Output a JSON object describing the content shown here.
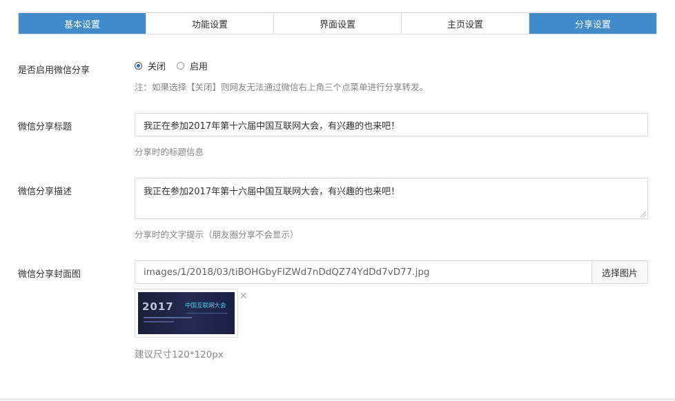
{
  "tabs": [
    {
      "label": "基本设置",
      "active": true
    },
    {
      "label": "功能设置",
      "active": false
    },
    {
      "label": "界面设置",
      "active": false
    },
    {
      "label": "主页设置",
      "active": false
    },
    {
      "label": "分享设置",
      "active": true
    }
  ],
  "share_enable": {
    "label": "是否启用微信分享",
    "options": [
      {
        "label": "关闭",
        "checked": true
      },
      {
        "label": "启用",
        "checked": false
      }
    ],
    "help": "注：如果选择【关闭】则网友无法通过微信右上角三个点菜单进行分享转发。"
  },
  "share_title": {
    "label": "微信分享标题",
    "value": "我正在参加2017年第十六届中国互联网大会，有兴趣的也来吧！",
    "help": "分享时的标题信息"
  },
  "share_desc": {
    "label": "微信分享描述",
    "value": "我正在参加2017年第十六届中国互联网大会，有兴趣的也来吧！",
    "help": "分享时的文字提示（朋友圈分享不会显示）"
  },
  "share_cover": {
    "label": "微信分享封面图",
    "path": "images/1/2018/03/tiBOHGbyFIZWd7nDdQZ74YdDd7vD77.jpg",
    "button": "选择图片",
    "thumb_year": "2017",
    "thumb_title": "中国互联网大会",
    "help": "建议尺寸120*120px"
  },
  "icons": {
    "close": "close-icon"
  },
  "colors": {
    "accent": "#428bca",
    "help_text": "#888888",
    "border": "#dcdcdc"
  }
}
